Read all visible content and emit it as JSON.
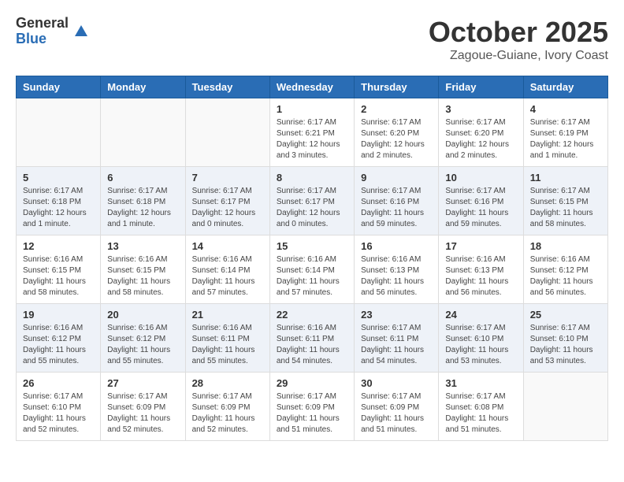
{
  "header": {
    "logo_general": "General",
    "logo_blue": "Blue",
    "month_title": "October 2025",
    "location": "Zagoue-Guiane, Ivory Coast"
  },
  "days_of_week": [
    "Sunday",
    "Monday",
    "Tuesday",
    "Wednesday",
    "Thursday",
    "Friday",
    "Saturday"
  ],
  "weeks": [
    [
      {
        "day": "",
        "info": ""
      },
      {
        "day": "",
        "info": ""
      },
      {
        "day": "",
        "info": ""
      },
      {
        "day": "1",
        "info": "Sunrise: 6:17 AM\nSunset: 6:21 PM\nDaylight: 12 hours\nand 3 minutes."
      },
      {
        "day": "2",
        "info": "Sunrise: 6:17 AM\nSunset: 6:20 PM\nDaylight: 12 hours\nand 2 minutes."
      },
      {
        "day": "3",
        "info": "Sunrise: 6:17 AM\nSunset: 6:20 PM\nDaylight: 12 hours\nand 2 minutes."
      },
      {
        "day": "4",
        "info": "Sunrise: 6:17 AM\nSunset: 6:19 PM\nDaylight: 12 hours\nand 1 minute."
      }
    ],
    [
      {
        "day": "5",
        "info": "Sunrise: 6:17 AM\nSunset: 6:18 PM\nDaylight: 12 hours\nand 1 minute."
      },
      {
        "day": "6",
        "info": "Sunrise: 6:17 AM\nSunset: 6:18 PM\nDaylight: 12 hours\nand 1 minute."
      },
      {
        "day": "7",
        "info": "Sunrise: 6:17 AM\nSunset: 6:17 PM\nDaylight: 12 hours\nand 0 minutes."
      },
      {
        "day": "8",
        "info": "Sunrise: 6:17 AM\nSunset: 6:17 PM\nDaylight: 12 hours\nand 0 minutes."
      },
      {
        "day": "9",
        "info": "Sunrise: 6:17 AM\nSunset: 6:16 PM\nDaylight: 11 hours\nand 59 minutes."
      },
      {
        "day": "10",
        "info": "Sunrise: 6:17 AM\nSunset: 6:16 PM\nDaylight: 11 hours\nand 59 minutes."
      },
      {
        "day": "11",
        "info": "Sunrise: 6:17 AM\nSunset: 6:15 PM\nDaylight: 11 hours\nand 58 minutes."
      }
    ],
    [
      {
        "day": "12",
        "info": "Sunrise: 6:16 AM\nSunset: 6:15 PM\nDaylight: 11 hours\nand 58 minutes."
      },
      {
        "day": "13",
        "info": "Sunrise: 6:16 AM\nSunset: 6:15 PM\nDaylight: 11 hours\nand 58 minutes."
      },
      {
        "day": "14",
        "info": "Sunrise: 6:16 AM\nSunset: 6:14 PM\nDaylight: 11 hours\nand 57 minutes."
      },
      {
        "day": "15",
        "info": "Sunrise: 6:16 AM\nSunset: 6:14 PM\nDaylight: 11 hours\nand 57 minutes."
      },
      {
        "day": "16",
        "info": "Sunrise: 6:16 AM\nSunset: 6:13 PM\nDaylight: 11 hours\nand 56 minutes."
      },
      {
        "day": "17",
        "info": "Sunrise: 6:16 AM\nSunset: 6:13 PM\nDaylight: 11 hours\nand 56 minutes."
      },
      {
        "day": "18",
        "info": "Sunrise: 6:16 AM\nSunset: 6:12 PM\nDaylight: 11 hours\nand 56 minutes."
      }
    ],
    [
      {
        "day": "19",
        "info": "Sunrise: 6:16 AM\nSunset: 6:12 PM\nDaylight: 11 hours\nand 55 minutes."
      },
      {
        "day": "20",
        "info": "Sunrise: 6:16 AM\nSunset: 6:12 PM\nDaylight: 11 hours\nand 55 minutes."
      },
      {
        "day": "21",
        "info": "Sunrise: 6:16 AM\nSunset: 6:11 PM\nDaylight: 11 hours\nand 55 minutes."
      },
      {
        "day": "22",
        "info": "Sunrise: 6:16 AM\nSunset: 6:11 PM\nDaylight: 11 hours\nand 54 minutes."
      },
      {
        "day": "23",
        "info": "Sunrise: 6:17 AM\nSunset: 6:11 PM\nDaylight: 11 hours\nand 54 minutes."
      },
      {
        "day": "24",
        "info": "Sunrise: 6:17 AM\nSunset: 6:10 PM\nDaylight: 11 hours\nand 53 minutes."
      },
      {
        "day": "25",
        "info": "Sunrise: 6:17 AM\nSunset: 6:10 PM\nDaylight: 11 hours\nand 53 minutes."
      }
    ],
    [
      {
        "day": "26",
        "info": "Sunrise: 6:17 AM\nSunset: 6:10 PM\nDaylight: 11 hours\nand 52 minutes."
      },
      {
        "day": "27",
        "info": "Sunrise: 6:17 AM\nSunset: 6:09 PM\nDaylight: 11 hours\nand 52 minutes."
      },
      {
        "day": "28",
        "info": "Sunrise: 6:17 AM\nSunset: 6:09 PM\nDaylight: 11 hours\nand 52 minutes."
      },
      {
        "day": "29",
        "info": "Sunrise: 6:17 AM\nSunset: 6:09 PM\nDaylight: 11 hours\nand 51 minutes."
      },
      {
        "day": "30",
        "info": "Sunrise: 6:17 AM\nSunset: 6:09 PM\nDaylight: 11 hours\nand 51 minutes."
      },
      {
        "day": "31",
        "info": "Sunrise: 6:17 AM\nSunset: 6:08 PM\nDaylight: 11 hours\nand 51 minutes."
      },
      {
        "day": "",
        "info": ""
      }
    ]
  ]
}
